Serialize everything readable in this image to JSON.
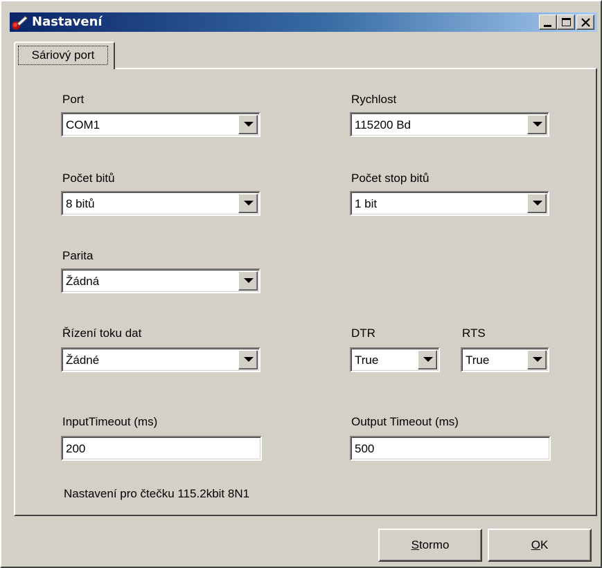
{
  "window": {
    "title": "Nastavení"
  },
  "tabs": [
    {
      "label": "Sáriový port",
      "selected": true
    }
  ],
  "fields": {
    "port": {
      "label": "Port",
      "value": "COM1"
    },
    "rychlost": {
      "label": "Rychlost",
      "value": "115200 Bd"
    },
    "pocet_bitu": {
      "label": "Počet bitů",
      "value": "8 bitů"
    },
    "pocet_stop_bitu": {
      "label": "Počet stop bitů",
      "value": "1 bit"
    },
    "parita": {
      "label": "Parita",
      "value": "Žádná"
    },
    "rizeni_toku": {
      "label": "Řízení toku dat",
      "value": "Žádné"
    },
    "dtr": {
      "label": "DTR",
      "value": "True"
    },
    "rts": {
      "label": "RTS",
      "value": "True"
    },
    "input_timeout": {
      "label": "InputTimeout  (ms)",
      "value": "200"
    },
    "output_timeout": {
      "label": "Output Timeout (ms)",
      "value": "500"
    }
  },
  "note": "Nastavení pro čtečku 115.2kbit 8N1",
  "buttons": {
    "cancel": {
      "mnemonic": "S",
      "rest": "tormo"
    },
    "ok": {
      "mnemonic": "O",
      "rest": "K"
    }
  },
  "icons": {
    "app": "pencil-icon",
    "minimize": "minimize-icon",
    "maximize": "maximize-icon",
    "close": "close-icon",
    "dropdown": "chevron-down-icon"
  },
  "colors": {
    "titlebar_start": "#0a246a",
    "titlebar_end": "#a6caf0",
    "face": "#d4d0c8"
  }
}
